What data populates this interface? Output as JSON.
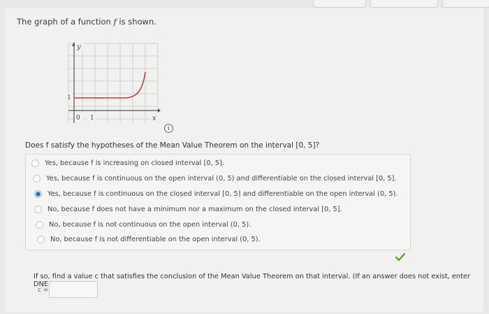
{
  "prompt": {
    "text_before": "The graph of a function ",
    "f": "f",
    "text_after": " is shown."
  },
  "graph": {
    "y_label": "y",
    "x_label": "x",
    "tick_y": "1",
    "tick_x_origin": "0",
    "tick_x_one": "1",
    "curve_color": "#cf2f3b"
  },
  "info_icon": "i",
  "question": "Does f satisfy the hypotheses of the Mean Value Theorem on the interval [0, 5]?",
  "options": [
    {
      "label": "Yes, because f is increasing on closed interval [0, 5].",
      "selected": false
    },
    {
      "label": "Yes, because f is continuous on the open interval (0, 5) and differentiable on the closed interval [0, 5].",
      "selected": false
    },
    {
      "label": "Yes, because f is continuous on the closed interval [0, 5] and differentiable on the open interval (0, 5).",
      "selected": true
    },
    {
      "label": "No, because f does not have a minimum nor a maximum on the closed interval [0, 5].",
      "selected": false
    },
    {
      "label": "No, because f is not continuous on the open interval (0, 5).",
      "selected": false
    },
    {
      "label": "No, because f is not differentiable on the open interval (0, 5).",
      "selected": false
    }
  ],
  "part2": {
    "question": "If so, find a value c that satisfies the conclusion of the Mean Value Theorem on that interval. (If an answer does not exist, enter DNE.)",
    "answer_label": "c =",
    "answer_value": ""
  },
  "colors": {
    "accent": "#2a6fbd",
    "check": "#5aa332",
    "curve": "#cf2f3b"
  }
}
